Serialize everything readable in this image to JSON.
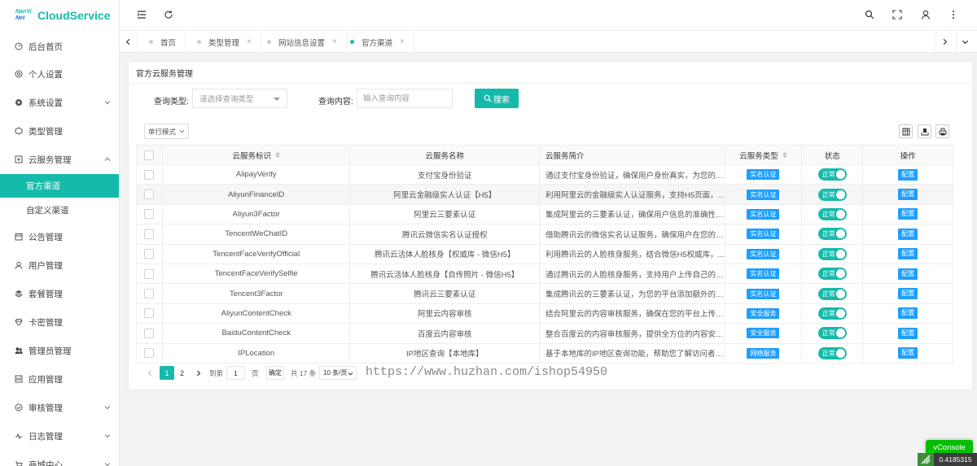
{
  "app": {
    "logo_top": "NanYi",
    "logo_bottom": "Net",
    "name": "CloudService",
    "accent_color": "#16baaa",
    "badge_color": "#1e9fff"
  },
  "sidebar": {
    "items": [
      {
        "label": "后台首页",
        "icon": "dashboard-icon",
        "chevron": "none"
      },
      {
        "label": "个人设置",
        "icon": "personal-settings-icon",
        "chevron": "none"
      },
      {
        "label": "系统设置",
        "icon": "system-settings-icon",
        "chevron": "down"
      },
      {
        "label": "类型管理",
        "icon": "type-icon",
        "chevron": "none"
      },
      {
        "label": "云服务管理",
        "icon": "cloud-service-icon",
        "chevron": "up",
        "children": [
          {
            "label": "官方渠道",
            "active": true
          },
          {
            "label": "自定义渠道",
            "active": false
          }
        ]
      },
      {
        "label": "公告管理",
        "icon": "notice-icon",
        "chevron": "none"
      },
      {
        "label": "用户管理",
        "icon": "user-icon",
        "chevron": "none"
      },
      {
        "label": "套餐管理",
        "icon": "package-icon",
        "chevron": "none"
      },
      {
        "label": "卡密管理",
        "icon": "card-key-icon",
        "chevron": "none"
      },
      {
        "label": "管理员管理",
        "icon": "admin-icon",
        "chevron": "none"
      },
      {
        "label": "应用管理",
        "icon": "app-icon",
        "chevron": "none"
      },
      {
        "label": "审核管理",
        "icon": "audit-icon",
        "chevron": "down"
      },
      {
        "label": "日志管理",
        "icon": "log-icon",
        "chevron": "down"
      },
      {
        "label": "商城中心",
        "icon": "shop-icon",
        "chevron": "down"
      }
    ]
  },
  "header": {
    "left_icons": [
      "menu-toggle-icon",
      "refresh-icon"
    ],
    "right_icons": [
      "search-icon",
      "fullscreen-icon",
      "user-icon",
      "more-icon"
    ]
  },
  "tabs": [
    {
      "label": "首页",
      "closable": false,
      "active": false
    },
    {
      "label": "类型管理",
      "closable": true,
      "active": false
    },
    {
      "label": "网站信息设置",
      "closable": true,
      "active": false
    },
    {
      "label": "官方渠道",
      "closable": true,
      "active": true
    }
  ],
  "tab_close_glyph": "×",
  "card": {
    "title": "官方云服务管理"
  },
  "search": {
    "type_label": "查询类型:",
    "type_placeholder": "请选择查询类型",
    "content_label": "查询内容:",
    "content_placeholder": "输入查询内容",
    "content_value": "",
    "button_label": "搜索"
  },
  "toolbar": {
    "mode_label": "单行模式",
    "right_icons": [
      "columns-icon",
      "export-icon",
      "print-icon"
    ]
  },
  "table": {
    "columns": [
      {
        "key": "check",
        "label": "",
        "sortable": false
      },
      {
        "key": "id",
        "label": "云服务标识",
        "sortable": true
      },
      {
        "key": "name",
        "label": "云服务名称",
        "sortable": false
      },
      {
        "key": "intro",
        "label": "云服务简介",
        "sortable": false
      },
      {
        "key": "type",
        "label": "云服务类型",
        "sortable": true
      },
      {
        "key": "status",
        "label": "状态",
        "sortable": false
      },
      {
        "key": "op",
        "label": "操作",
        "sortable": false
      }
    ],
    "rows": [
      {
        "id": "AlipayVerify",
        "name": "支付宝身份验证",
        "intro": "通过支付宝身份验证，确保用户身份真实，为您的平...",
        "type": "实名认证",
        "status": "正常",
        "op": "配置"
      },
      {
        "id": "AliyunFinanceID",
        "name": "阿里云金融级实人认证【H5】",
        "intro": "利用阿里云的金融级实人认证服务，支持H5页面，...",
        "type": "实名认证",
        "status": "正常",
        "op": "配置"
      },
      {
        "id": "Aliyun3Factor",
        "name": "阿里云三要素认证",
        "intro": "集成阿里云的三要素认证，确保用户信息的准确性，...",
        "type": "实名认证",
        "status": "正常",
        "op": "配置"
      },
      {
        "id": "TencentWeChatID",
        "name": "腾讯云微信实名认证授权",
        "intro": "借助腾讯云的微信实名认证服务，确保用户在您的平...",
        "type": "实名认证",
        "status": "正常",
        "op": "配置"
      },
      {
        "id": "TencentFaceVerifyOfficial",
        "name": "腾讯云活体人脸核身【权威库 - 微信H5】",
        "intro": "利用腾讯云的人脸核身服务，结合微信H5权威库，...",
        "type": "实名认证",
        "status": "正常",
        "op": "配置"
      },
      {
        "id": "TencentFaceVerifySelfie",
        "name": "腾讯云活体人脸核身【自传照片 - 微信H5】",
        "intro": "通过腾讯云的人脸核身服务，支持用户上传自己的照...",
        "type": "实名认证",
        "status": "正常",
        "op": "配置"
      },
      {
        "id": "Tencent3Factor",
        "name": "腾讯云三要素认证",
        "intro": "集成腾讯云的三要素认证，为您的平台添加额外的用...",
        "type": "实名认证",
        "status": "正常",
        "op": "配置"
      },
      {
        "id": "AliyunContentCheck",
        "name": "阿里云内容审核",
        "intro": "结合阿里云的内容审核服务，确保在您的平台上传的...",
        "type": "安全服务",
        "status": "正常",
        "op": "配置"
      },
      {
        "id": "BaiduContentCheck",
        "name": "百度云内容审核",
        "intro": "整合百度云的内容审核服务，提供全方位的内容安全...",
        "type": "安全服务",
        "status": "正常",
        "op": "配置"
      },
      {
        "id": "IPLocation",
        "name": "IP地区查询【本地库】",
        "intro": "基于本地库的IP地区查询功能，帮助您了解访问者的...",
        "type": "网络服务",
        "status": "正常",
        "op": "配置"
      }
    ]
  },
  "pagination": {
    "pages": [
      "1",
      "2"
    ],
    "current": "1",
    "jump_label": "到第",
    "jump_value": "1",
    "page_unit": "页",
    "confirm_label": "确定",
    "total_text": "共 17 条",
    "per_page": "10 条/页"
  },
  "watermark": "https://www.huzhan.com/ishop54950",
  "vconsole": {
    "label": "vConsole",
    "value": "0.4185315"
  }
}
